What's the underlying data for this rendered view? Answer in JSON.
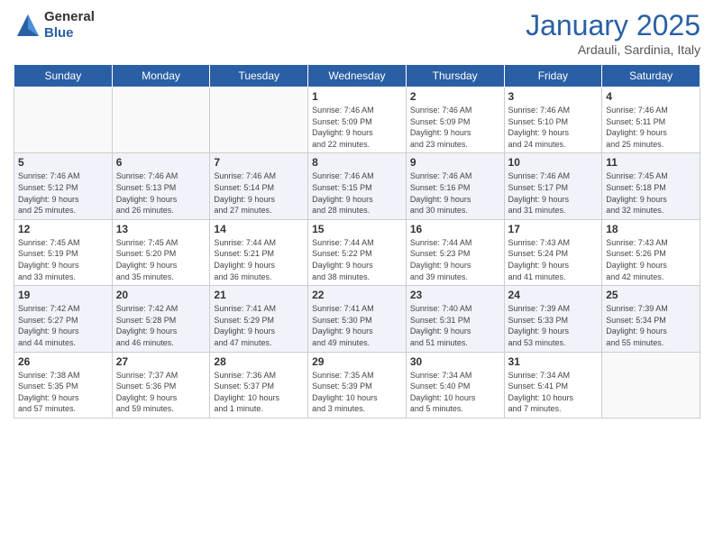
{
  "header": {
    "logo_general": "General",
    "logo_blue": "Blue",
    "month_year": "January 2025",
    "location": "Ardauli, Sardinia, Italy"
  },
  "days_of_week": [
    "Sunday",
    "Monday",
    "Tuesday",
    "Wednesday",
    "Thursday",
    "Friday",
    "Saturday"
  ],
  "weeks": [
    {
      "row_bg": "#fff",
      "days": [
        {
          "num": "",
          "detail": ""
        },
        {
          "num": "",
          "detail": ""
        },
        {
          "num": "",
          "detail": ""
        },
        {
          "num": "1",
          "detail": "Sunrise: 7:46 AM\nSunset: 5:09 PM\nDaylight: 9 hours\nand 22 minutes."
        },
        {
          "num": "2",
          "detail": "Sunrise: 7:46 AM\nSunset: 5:09 PM\nDaylight: 9 hours\nand 23 minutes."
        },
        {
          "num": "3",
          "detail": "Sunrise: 7:46 AM\nSunset: 5:10 PM\nDaylight: 9 hours\nand 24 minutes."
        },
        {
          "num": "4",
          "detail": "Sunrise: 7:46 AM\nSunset: 5:11 PM\nDaylight: 9 hours\nand 25 minutes."
        }
      ]
    },
    {
      "row_bg": "#f0f4fa",
      "days": [
        {
          "num": "5",
          "detail": "Sunrise: 7:46 AM\nSunset: 5:12 PM\nDaylight: 9 hours\nand 25 minutes."
        },
        {
          "num": "6",
          "detail": "Sunrise: 7:46 AM\nSunset: 5:13 PM\nDaylight: 9 hours\nand 26 minutes."
        },
        {
          "num": "7",
          "detail": "Sunrise: 7:46 AM\nSunset: 5:14 PM\nDaylight: 9 hours\nand 27 minutes."
        },
        {
          "num": "8",
          "detail": "Sunrise: 7:46 AM\nSunset: 5:15 PM\nDaylight: 9 hours\nand 28 minutes."
        },
        {
          "num": "9",
          "detail": "Sunrise: 7:46 AM\nSunset: 5:16 PM\nDaylight: 9 hours\nand 30 minutes."
        },
        {
          "num": "10",
          "detail": "Sunrise: 7:46 AM\nSunset: 5:17 PM\nDaylight: 9 hours\nand 31 minutes."
        },
        {
          "num": "11",
          "detail": "Sunrise: 7:45 AM\nSunset: 5:18 PM\nDaylight: 9 hours\nand 32 minutes."
        }
      ]
    },
    {
      "row_bg": "#fff",
      "days": [
        {
          "num": "12",
          "detail": "Sunrise: 7:45 AM\nSunset: 5:19 PM\nDaylight: 9 hours\nand 33 minutes."
        },
        {
          "num": "13",
          "detail": "Sunrise: 7:45 AM\nSunset: 5:20 PM\nDaylight: 9 hours\nand 35 minutes."
        },
        {
          "num": "14",
          "detail": "Sunrise: 7:44 AM\nSunset: 5:21 PM\nDaylight: 9 hours\nand 36 minutes."
        },
        {
          "num": "15",
          "detail": "Sunrise: 7:44 AM\nSunset: 5:22 PM\nDaylight: 9 hours\nand 38 minutes."
        },
        {
          "num": "16",
          "detail": "Sunrise: 7:44 AM\nSunset: 5:23 PM\nDaylight: 9 hours\nand 39 minutes."
        },
        {
          "num": "17",
          "detail": "Sunrise: 7:43 AM\nSunset: 5:24 PM\nDaylight: 9 hours\nand 41 minutes."
        },
        {
          "num": "18",
          "detail": "Sunrise: 7:43 AM\nSunset: 5:26 PM\nDaylight: 9 hours\nand 42 minutes."
        }
      ]
    },
    {
      "row_bg": "#f0f4fa",
      "days": [
        {
          "num": "19",
          "detail": "Sunrise: 7:42 AM\nSunset: 5:27 PM\nDaylight: 9 hours\nand 44 minutes."
        },
        {
          "num": "20",
          "detail": "Sunrise: 7:42 AM\nSunset: 5:28 PM\nDaylight: 9 hours\nand 46 minutes."
        },
        {
          "num": "21",
          "detail": "Sunrise: 7:41 AM\nSunset: 5:29 PM\nDaylight: 9 hours\nand 47 minutes."
        },
        {
          "num": "22",
          "detail": "Sunrise: 7:41 AM\nSunset: 5:30 PM\nDaylight: 9 hours\nand 49 minutes."
        },
        {
          "num": "23",
          "detail": "Sunrise: 7:40 AM\nSunset: 5:31 PM\nDaylight: 9 hours\nand 51 minutes."
        },
        {
          "num": "24",
          "detail": "Sunrise: 7:39 AM\nSunset: 5:33 PM\nDaylight: 9 hours\nand 53 minutes."
        },
        {
          "num": "25",
          "detail": "Sunrise: 7:39 AM\nSunset: 5:34 PM\nDaylight: 9 hours\nand 55 minutes."
        }
      ]
    },
    {
      "row_bg": "#fff",
      "days": [
        {
          "num": "26",
          "detail": "Sunrise: 7:38 AM\nSunset: 5:35 PM\nDaylight: 9 hours\nand 57 minutes."
        },
        {
          "num": "27",
          "detail": "Sunrise: 7:37 AM\nSunset: 5:36 PM\nDaylight: 9 hours\nand 59 minutes."
        },
        {
          "num": "28",
          "detail": "Sunrise: 7:36 AM\nSunset: 5:37 PM\nDaylight: 10 hours\nand 1 minute."
        },
        {
          "num": "29",
          "detail": "Sunrise: 7:35 AM\nSunset: 5:39 PM\nDaylight: 10 hours\nand 3 minutes."
        },
        {
          "num": "30",
          "detail": "Sunrise: 7:34 AM\nSunset: 5:40 PM\nDaylight: 10 hours\nand 5 minutes."
        },
        {
          "num": "31",
          "detail": "Sunrise: 7:34 AM\nSunset: 5:41 PM\nDaylight: 10 hours\nand 7 minutes."
        },
        {
          "num": "",
          "detail": ""
        }
      ]
    }
  ]
}
